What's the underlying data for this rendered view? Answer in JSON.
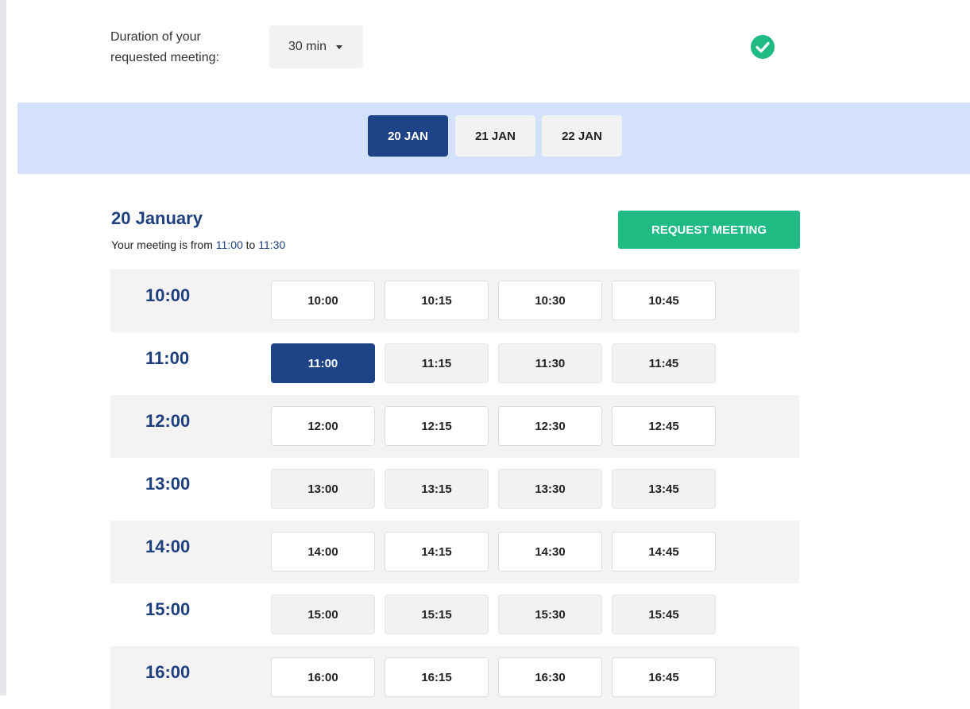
{
  "duration": {
    "label": "Duration of your requested meeting:",
    "value": "30 min"
  },
  "status_icon": "check-circle-icon",
  "dates": [
    {
      "label": "20 JAN",
      "active": true
    },
    {
      "label": "21 JAN",
      "active": false
    },
    {
      "label": "22 JAN",
      "active": false
    }
  ],
  "day": {
    "title": "20 January",
    "summary_prefix": "Your meeting is from",
    "start": "11:00",
    "connector": "to",
    "end": "11:30"
  },
  "request_button": "REQUEST MEETING",
  "hours": [
    {
      "label": "10:00",
      "slots": [
        "10:00",
        "10:15",
        "10:30",
        "10:45"
      ]
    },
    {
      "label": "11:00",
      "slots": [
        "11:00",
        "11:15",
        "11:30",
        "11:45"
      ]
    },
    {
      "label": "12:00",
      "slots": [
        "12:00",
        "12:15",
        "12:30",
        "12:45"
      ]
    },
    {
      "label": "13:00",
      "slots": [
        "13:00",
        "13:15",
        "13:30",
        "13:45"
      ]
    },
    {
      "label": "14:00",
      "slots": [
        "14:00",
        "14:15",
        "14:30",
        "14:45"
      ]
    },
    {
      "label": "15:00",
      "slots": [
        "15:00",
        "15:15",
        "15:30",
        "15:45"
      ]
    },
    {
      "label": "16:00",
      "slots": [
        "16:00",
        "16:15",
        "16:30",
        "16:45"
      ]
    }
  ],
  "selected_slot": "11:00",
  "colors": {
    "accent_navy": "#1e4487",
    "success_green": "#1fbb83",
    "band_blue": "#d4e1fb"
  }
}
